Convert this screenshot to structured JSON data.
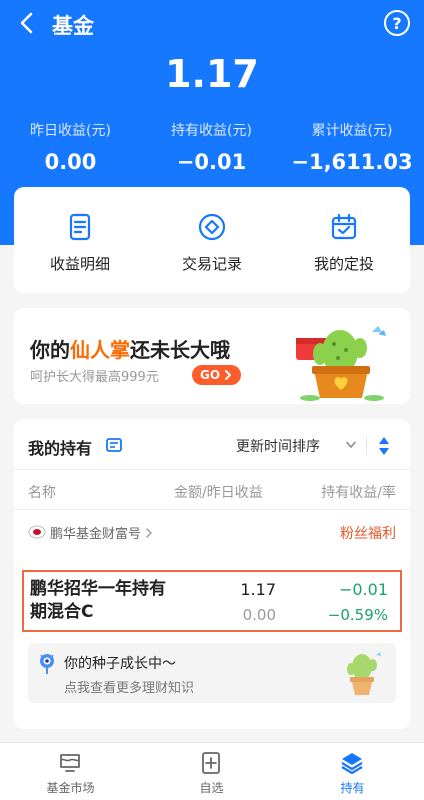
{
  "header": {
    "title": "基金",
    "total": "1.17",
    "stats": [
      {
        "label": "昨日收益(元)",
        "value": "0.00"
      },
      {
        "label": "持有收益(元)",
        "value": "−0.01"
      },
      {
        "label": "累计收益(元)",
        "value": "−1,611.03"
      }
    ]
  },
  "quick_actions": [
    {
      "label": "收益明细",
      "icon": "document-icon"
    },
    {
      "label": "交易记录",
      "icon": "diamond-icon"
    },
    {
      "label": "我的定投",
      "icon": "calendar-check-icon"
    }
  ],
  "promo": {
    "title_pre": "你的",
    "title_highlight": "仙人掌",
    "title_post": "还未长大哦",
    "subtitle": "呵护长大得最高999元",
    "button": "GO"
  },
  "holdings": {
    "title": "我的持有",
    "sort_label": "更新时间排序",
    "columns": [
      "名称",
      "金额/昨日收益",
      "持有收益/率"
    ],
    "brand_name": "鹏华基金财富号",
    "brand_tag": "粉丝福利",
    "fund": {
      "name": "鹏华招华一年持有期混合C",
      "amount": "1.17",
      "yesterday": "0.00",
      "profit": "−0.01",
      "rate": "−0.59%"
    },
    "seed": {
      "title": "你的种子成长中～",
      "subtitle": "点我查看更多理财知识"
    }
  },
  "tabbar": [
    {
      "label": "基金市场",
      "icon": "market-icon"
    },
    {
      "label": "自选",
      "icon": "watchlist-icon"
    },
    {
      "label": "持有",
      "icon": "layers-icon",
      "active": true
    }
  ],
  "colors": {
    "brand_blue": "#1677ff",
    "loss_green": "#1aa36b",
    "highlight_orange": "#ff6a00"
  }
}
